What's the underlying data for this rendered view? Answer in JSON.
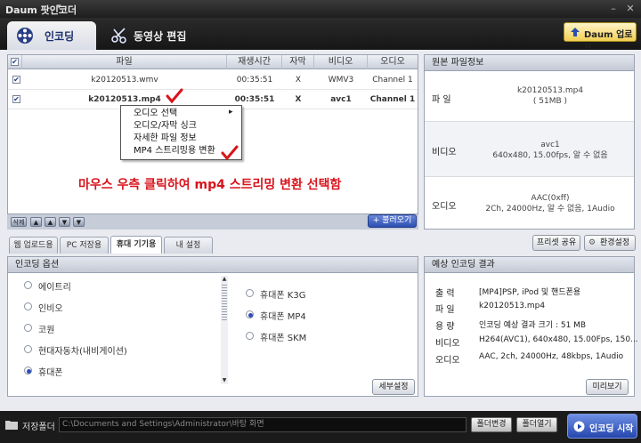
{
  "app": {
    "title": "Daum 팟인코더",
    "title_arrow": "▾"
  },
  "window_controls": {
    "minimize": "–",
    "close": "✕"
  },
  "main_tabs": [
    {
      "label": "인코딩",
      "icon": "film-reel-icon",
      "active": true
    },
    {
      "label": "동영상 편집",
      "icon": "scissors-icon",
      "active": false
    }
  ],
  "daum_update": {
    "label": "Daum 업로드",
    "icon": "upload-arrow-icon"
  },
  "file_list": {
    "columns": [
      "파일",
      "재생시간",
      "자막",
      "비디오",
      "오디오"
    ],
    "rows": [
      {
        "checked": "✔",
        "file": "k20120513.wmv",
        "duration": "00:35:51",
        "subtitle": "X",
        "video": "WMV3",
        "audio": "Channel 1"
      },
      {
        "checked": "✔",
        "file": "k20120513.mp4",
        "duration": "00:35:51",
        "subtitle": "X",
        "video": "avc1",
        "audio": "Channel 1"
      }
    ],
    "header_check": "✔"
  },
  "context_menu": {
    "items": [
      "오디오 선택",
      "오디오/자막 싱크",
      "자세한 파일 정보",
      "MP4 스트리밍용 변환"
    ],
    "submenu_arrow": "▸"
  },
  "annotation": "마우스 우측 클릭하여 mp4 스트리밍 변환 선택함",
  "list_toolbar": {
    "delete": "삭제",
    "arrows": [
      "▲",
      "▲",
      "▼",
      "▼"
    ],
    "add_files": "+ 불러오기"
  },
  "source_info": {
    "title": "원본 파일정보",
    "file_label": "파 일",
    "file_value": [
      "k20120513.mp4",
      "( 51MB )"
    ],
    "video_label": "비디오",
    "video_value": [
      "avc1",
      "640x480, 15.00fps, 알 수 없음"
    ],
    "audio_label": "오디오",
    "audio_value": [
      "AAC(0xff)",
      "2Ch, 24000Hz, 알 수 없음, 1Audio"
    ]
  },
  "sub_tabs": [
    {
      "label": "웹 업로드용",
      "active": false
    },
    {
      "label": "PC 저장용",
      "active": false
    },
    {
      "label": "휴대 기기용",
      "active": true
    },
    {
      "label": "내 설정",
      "active": false
    }
  ],
  "preset_share": "프리셋 공유",
  "env_settings": "환경설정",
  "enc_options": {
    "title": "인코딩 옵션",
    "devices": [
      {
        "label": "에이트리",
        "selected": false
      },
      {
        "label": "인비오",
        "selected": false
      },
      {
        "label": "코원",
        "selected": false
      },
      {
        "label": "현대자동차(내비게이션)",
        "selected": false
      },
      {
        "label": "휴대폰",
        "selected": true
      }
    ],
    "formats": [
      {
        "label": "휴대폰 K3G",
        "selected": false
      },
      {
        "label": "휴대폰 MP4",
        "selected": true
      },
      {
        "label": "휴대폰 SKM",
        "selected": false
      }
    ],
    "detail_button": "세부설정"
  },
  "enc_result": {
    "title": "예상 인코딩 결과",
    "rows": [
      {
        "label": "출 력",
        "value": "[MP4]PSP, iPod 및 핸드폰용"
      },
      {
        "label": "파 일",
        "value": "k20120513.mp4"
      },
      {
        "label": "용 량",
        "value": "인코딩 예상 결과 크기 : 51 MB"
      },
      {
        "label": "비디오",
        "value": "H264(AVC1), 640x480, 15.00Fps, 150..."
      },
      {
        "label": "오디오",
        "value": "AAC, 2ch, 24000Hz, 48kbps, 1Audio"
      }
    ],
    "preview_button": "미리보기"
  },
  "bottom": {
    "save_folder_label": "저장폴더",
    "path": "C:\\Documents and Settings\\Administrator\\바탕 화면",
    "change_folder": "폴더변경",
    "open_folder": "폴더열기",
    "start_button": "인코딩 시작"
  },
  "colors": {
    "accent": "#2b4db5",
    "annotation": "#d8141c",
    "frame": "#1b1b1b"
  }
}
